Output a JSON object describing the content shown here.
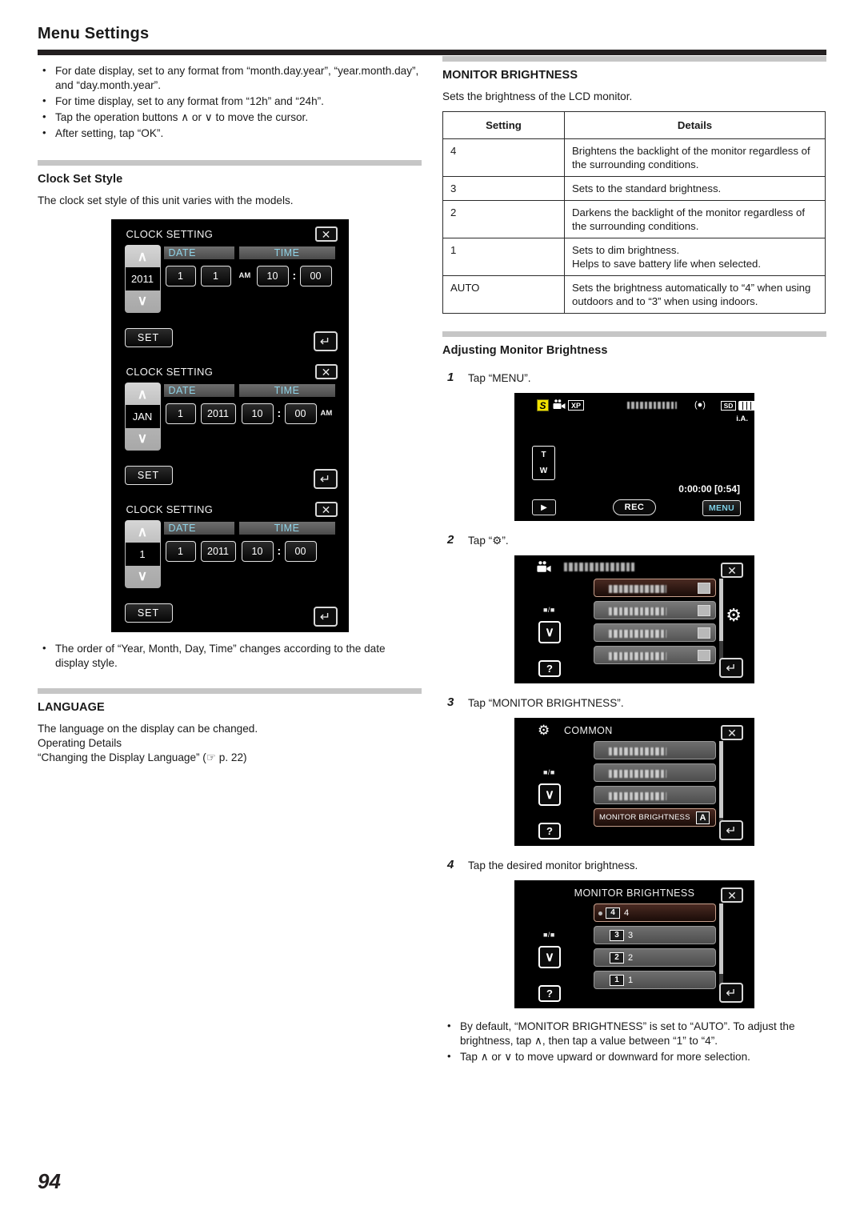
{
  "page": {
    "title": "Menu Settings",
    "number": "94"
  },
  "left": {
    "intro_bullets": [
      "For date display, set to any format from “month.day.year”, “year.month.day”, and “day.month.year”.",
      "For time display, set to any format from “12h” and “24h”.",
      "Tap the operation buttons ∧ or ∨ to move the cursor.",
      "After setting, tap “OK”."
    ],
    "clock_set_style": {
      "heading": "Clock Set Style",
      "description": "The clock set style of this unit varies with the models.",
      "screens": [
        {
          "title": "CLOCK SETTING",
          "spinner_value": "2011",
          "date_label": "DATE",
          "time_label": "TIME",
          "field1": "1",
          "field2": "1",
          "ampm": "AM",
          "ampm_position": "before",
          "hour": "10",
          "minute": "00",
          "set_label": "SET",
          "close_icon": "close-icon",
          "back_icon": "back-icon"
        },
        {
          "title": "CLOCK SETTING",
          "spinner_value": "JAN",
          "date_label": "DATE",
          "time_label": "TIME",
          "field1": "1",
          "field2": "2011",
          "ampm": "AM",
          "ampm_position": "after",
          "hour": "10",
          "minute": "00",
          "set_label": "SET",
          "close_icon": "close-icon",
          "back_icon": "back-icon"
        },
        {
          "title": "CLOCK SETTING",
          "spinner_value": "1",
          "date_label": "DATE",
          "time_label": "TIME",
          "field1": "1",
          "field2": "2011",
          "ampm": "",
          "ampm_position": "none",
          "hour": "10",
          "minute": "00",
          "set_label": "SET",
          "close_icon": "close-icon",
          "back_icon": "back-icon"
        }
      ],
      "note": "The order of “Year, Month, Day, Time” changes according to the date display style."
    },
    "language": {
      "heading": "LANGUAGE",
      "line1": "The language on the display can be changed.",
      "line2": "Operating Details",
      "line3": "“Changing the Display Language” (☞ p. 22)"
    }
  },
  "right": {
    "monitor_brightness": {
      "heading": "MONITOR BRIGHTNESS",
      "description": "Sets the brightness of the LCD monitor.",
      "table": {
        "headers": [
          "Setting",
          "Details"
        ],
        "rows": [
          {
            "setting": "4",
            "details": "Brightens the backlight of the monitor regardless of the surrounding conditions."
          },
          {
            "setting": "3",
            "details": "Sets to the standard brightness."
          },
          {
            "setting": "2",
            "details": "Darkens the backlight of the monitor regardless of the surrounding conditions."
          },
          {
            "setting": "1",
            "details": "Sets to dim brightness.\nHelps to save battery life when selected."
          },
          {
            "setting": "AUTO",
            "details": "Sets the brightness automatically to “4” when using outdoors and to “3” when using indoors."
          }
        ]
      }
    },
    "adjusting": {
      "heading": "Adjusting Monitor Brightness",
      "steps": [
        {
          "num": "1",
          "text": "Tap “MENU”."
        },
        {
          "num": "2",
          "text": "Tap “⚙”."
        },
        {
          "num": "3",
          "text": "Tap “MONITOR BRIGHTNESS”."
        },
        {
          "num": "4",
          "text": "Tap the desired monitor brightness."
        }
      ],
      "rec_screen": {
        "icon_s": "S",
        "icon_camcorder": "camcorder-icon",
        "icon_xp": "XP",
        "icon_stabilizer": "image-stabilizer-icon",
        "icon_sd": "SD",
        "icon_battery": "battery-icon",
        "icon_d": "D",
        "label_ia": "i.A.",
        "zoom_t": "T",
        "zoom_w": "W",
        "timecode": "0:00:00 [0:54]",
        "play_label": "▶",
        "rec_label": "REC",
        "menu_label": "MENU"
      },
      "menu_screen": {
        "page_indicator": "■/■",
        "down_label": "∨",
        "help_label": "?",
        "gear_label": "gear-icon",
        "close_label": "close-icon",
        "back_label": "back-icon"
      },
      "common_screen": {
        "title": "COMMON",
        "selected_item": "MONITOR BRIGHTNESS",
        "selected_badge": "A",
        "page_indicator": "■/■",
        "down_label": "∨",
        "help_label": "?"
      },
      "brightness_screen": {
        "title": "MONITOR BRIGHTNESS",
        "items": [
          {
            "box": "4",
            "label": "4",
            "selected": true
          },
          {
            "box": "3",
            "label": "3",
            "selected": false
          },
          {
            "box": "2",
            "label": "2",
            "selected": false
          },
          {
            "box": "1",
            "label": "1",
            "selected": false
          }
        ],
        "page_indicator": "■/■",
        "down_label": "∨",
        "help_label": "?"
      },
      "notes": [
        "By default, “MONITOR BRIGHTNESS” is set to “AUTO”. To adjust the brightness, tap ∧, then tap a value between “1” to “4”.",
        "Tap ∧ or ∨ to move upward or downward for more selection."
      ]
    }
  }
}
